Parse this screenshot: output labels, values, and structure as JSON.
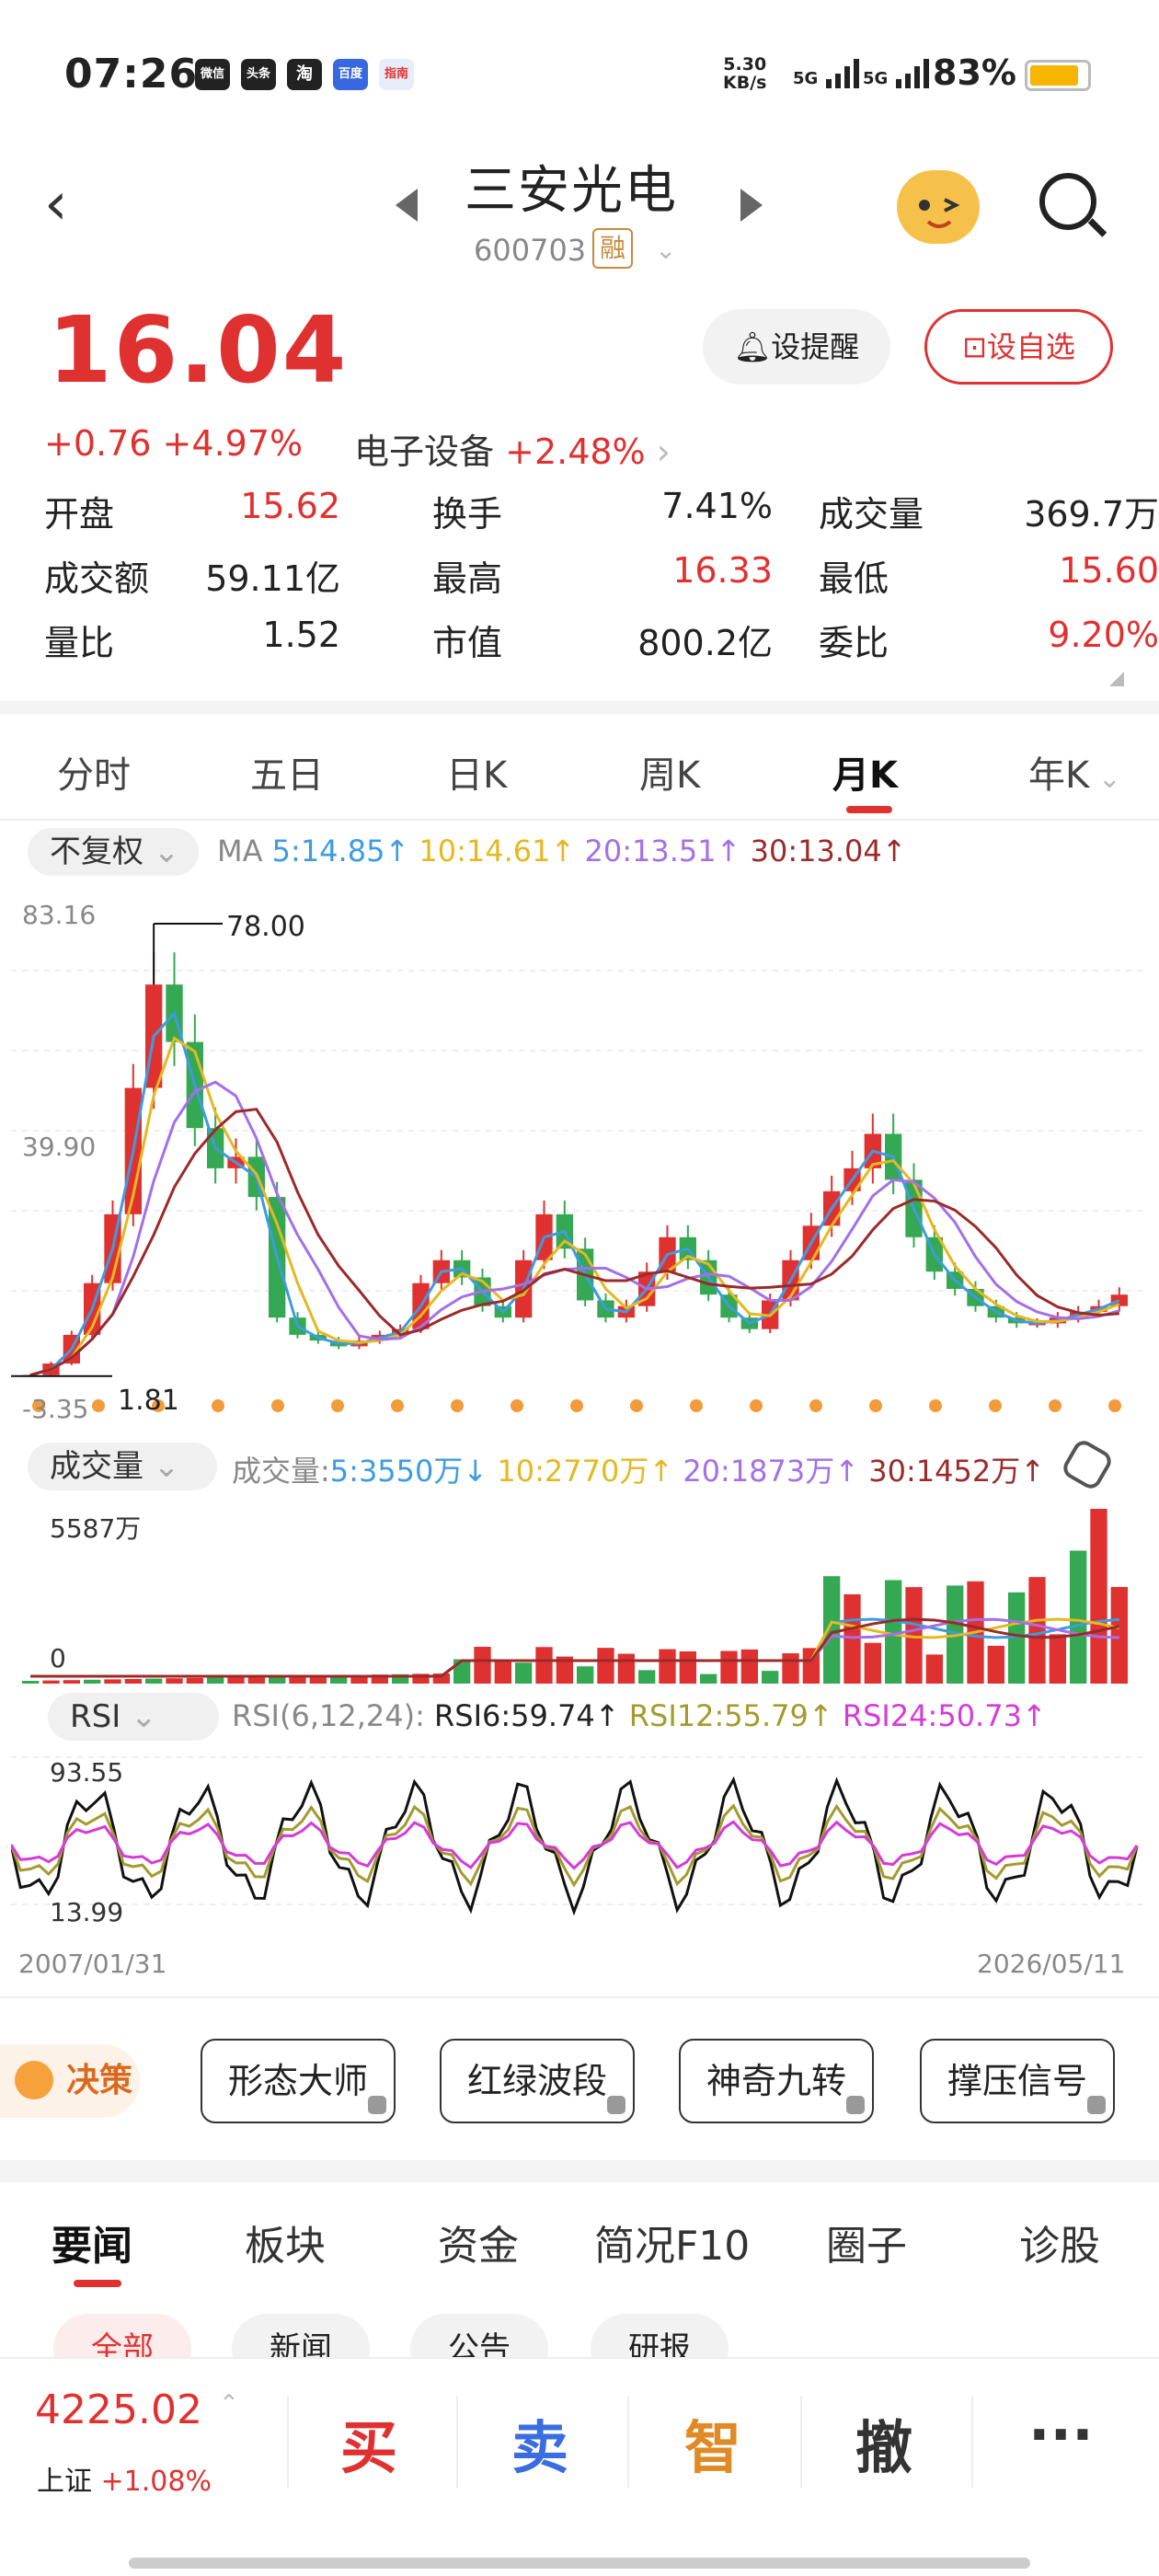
{
  "status": {
    "time": "07:26",
    "apps": [
      "微信",
      "头条",
      "淘",
      "百度",
      "指南"
    ],
    "netspeed": [
      "5.30",
      "KB/s"
    ],
    "net1": "5G",
    "net2": "5G",
    "battery": "83%"
  },
  "header": {
    "title": "三安光电",
    "code": "600703",
    "rong": "融"
  },
  "quote": {
    "price": "16.04",
    "change": "+0.76",
    "pct": "+4.97%",
    "sector": "电子设备",
    "sector_pct": "+2.48%",
    "remind": "设提醒",
    "add": "设自选",
    "stats": [
      {
        "label": "开盘",
        "value": "15.62"
      },
      {
        "label": "换手",
        "value": "7.41%"
      },
      {
        "label": "成交量",
        "value": "369.7万"
      },
      {
        "label": "成交额",
        "value": "59.11亿"
      },
      {
        "label": "最高",
        "value": "16.33"
      },
      {
        "label": "最低",
        "value": "15.60"
      },
      {
        "label": "量比",
        "value": "1.52"
      },
      {
        "label": "市值",
        "value": "800.2亿"
      },
      {
        "label": "委比",
        "value": "9.20%"
      }
    ]
  },
  "tabs": [
    "分时",
    "五日",
    "日K",
    "周K",
    "月K",
    "年K"
  ],
  "ma": {
    "adjust": "不复权",
    "label": "MA",
    "ma5": "5:14.85↑",
    "ma10": "10:14.61↑",
    "ma20": "20:13.51↑",
    "ma30": "30:13.04↑"
  },
  "kchart": {
    "ymax": "83.16",
    "ymid": "39.90",
    "ymin": "-3.35",
    "high": "78.00",
    "low": "1.81"
  },
  "volume": {
    "label": "成交量",
    "prefix": "成交量:",
    "v5": "5:3550万↓",
    "v10": "10:2770万↑",
    "v20": "20:1873万↑",
    "v30": "30:1452万↑",
    "ymax": "5587万",
    "ymin": "0"
  },
  "rsi": {
    "label": "RSI",
    "params": "RSI(6,12,24):",
    "r6": "RSI6:59.74↑",
    "r12": "RSI12:55.79↑",
    "r24": "RSI24:50.73↑",
    "ymax": "93.55",
    "ymin": "13.99"
  },
  "dates": {
    "start": "2007/01/31",
    "end": "2026/05/11"
  },
  "signals": {
    "jc": "决策",
    "items": [
      "形态大师",
      "红绿波段",
      "神奇九转",
      "撑压信号"
    ]
  },
  "news": {
    "tabs": [
      "要闻",
      "板块",
      "资金",
      "简况F10",
      "圈子",
      "诊股"
    ],
    "subtabs": [
      "全部",
      "新闻",
      "公告",
      "研报"
    ]
  },
  "bottom": {
    "index_value": "4225.02",
    "index_name": "上证",
    "index_pct": "+1.08%",
    "buy": "买",
    "sell": "卖",
    "smart": "智",
    "cancel": "撤",
    "more": "···"
  },
  "chart_data": {
    "type": "candlestick",
    "title": "",
    "x_range": [
      "2007/01/31",
      "2026/05/11"
    ],
    "ylim": [
      -3.35,
      83.16
    ],
    "annotations": [
      {
        "text": "78.00",
        "label": "max"
      },
      {
        "text": "1.81",
        "label": "min"
      }
    ],
    "close_approx": [
      2,
      4,
      9,
      18,
      30,
      52,
      70,
      60,
      45,
      38,
      40,
      33,
      12,
      9,
      8,
      7,
      8,
      9,
      10,
      18,
      22,
      19,
      14,
      12,
      22,
      30,
      24,
      15,
      12,
      14,
      20,
      26,
      22,
      16,
      12,
      10,
      15,
      22,
      28,
      34,
      38,
      44,
      36,
      26,
      20,
      17,
      14,
      12,
      11,
      11,
      12,
      13,
      14,
      16
    ],
    "ma": {
      "ma5": 14.85,
      "ma10": 14.61,
      "ma20": 13.51,
      "ma30": 13.04
    },
    "volume_max": "5587万",
    "rsi": {
      "rsi6": 59.74,
      "rsi12": 55.79,
      "rsi24": 50.73,
      "ymax": 93.55,
      "ymin": 13.99
    }
  }
}
